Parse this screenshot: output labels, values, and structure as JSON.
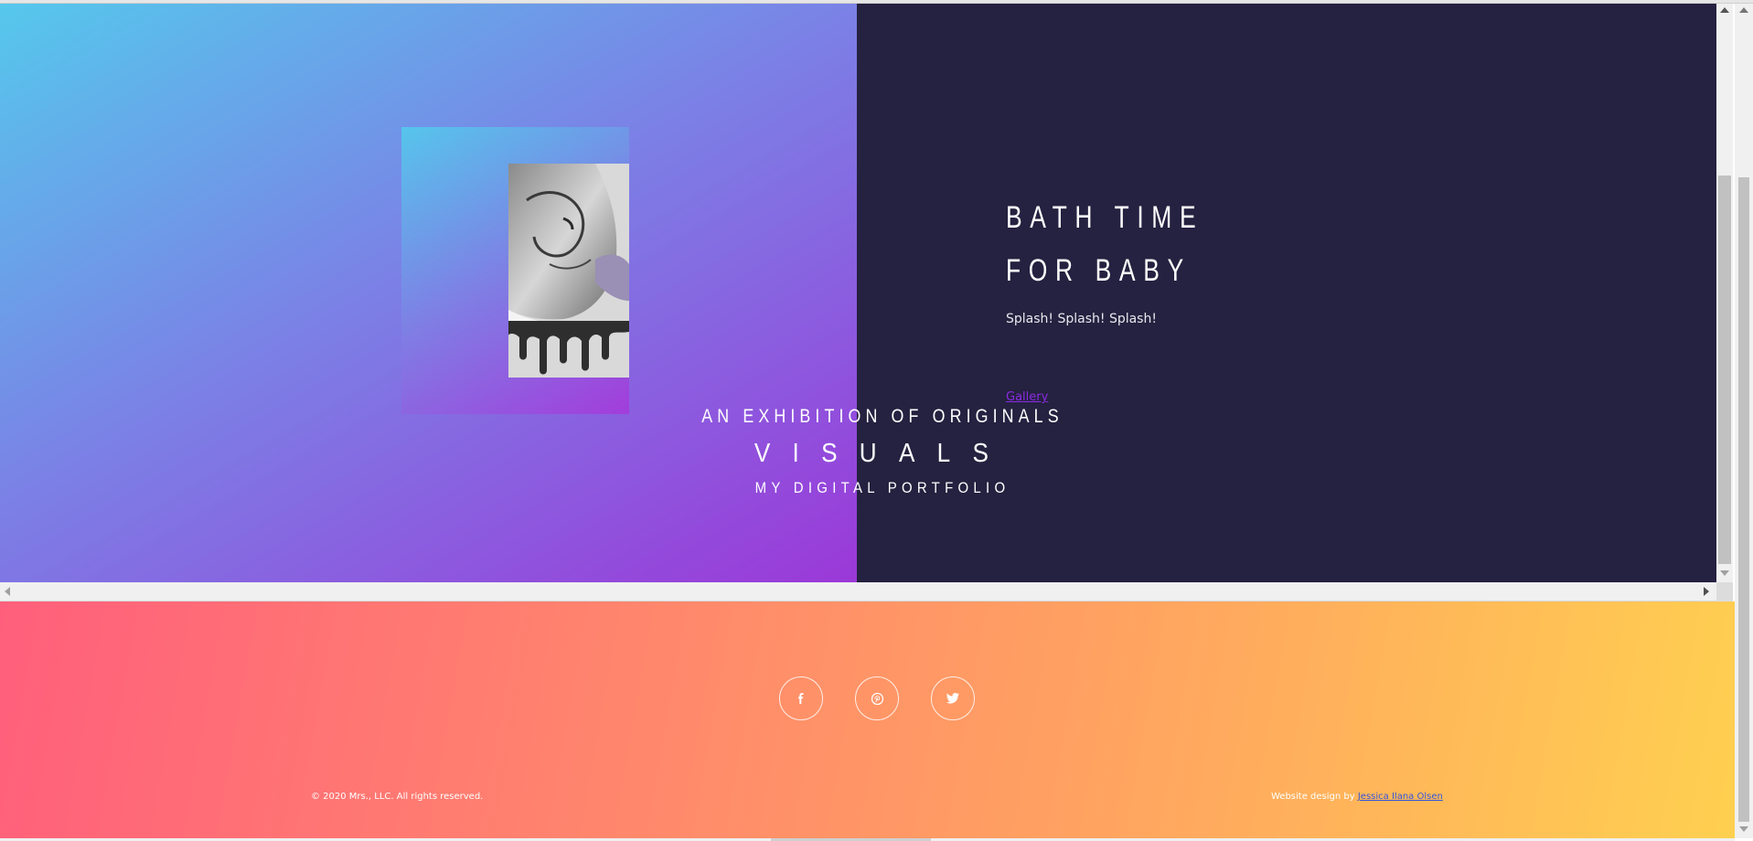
{
  "gallery": {
    "artwork": {
      "title": "BATH TIME FOR BABY",
      "subtitle": "Splash! Splash! Splash!",
      "link_label": "Gallery"
    },
    "hero": {
      "line1": "AN EXHIBITION OF ORIGINALS",
      "line2": "VISUALS",
      "line3": "MY DIGITAL PORTFOLIO"
    }
  },
  "footer": {
    "social": [
      {
        "name": "facebook",
        "icon": "facebook-icon"
      },
      {
        "name": "pinterest",
        "icon": "pinterest-icon"
      },
      {
        "name": "twitter",
        "icon": "twitter-icon"
      }
    ],
    "copyright": "© 2020 Mrs., LLC. All rights reserved.",
    "credit_prefix": "Website design by",
    "credit_link": "Jessica Ilana Olsen"
  },
  "colors": {
    "panel_dark": "#252140",
    "gradient_cyan": "#55c8ec",
    "gradient_purple": "#9b38d8",
    "footer_pink": "#ff5f7c",
    "footer_yellow": "#ffd050",
    "link_purple": "#8a2be2"
  }
}
